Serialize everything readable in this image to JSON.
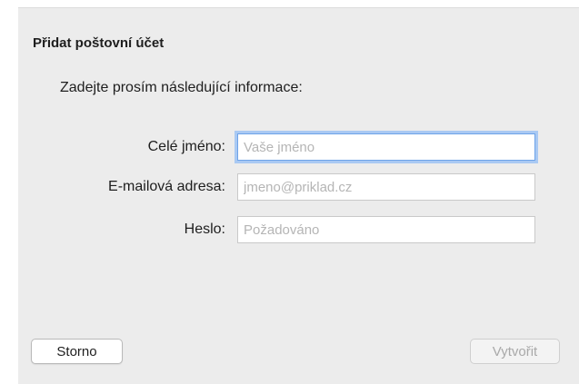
{
  "dialog": {
    "title": "Přidat poštovní účet",
    "subtitle": "Zadejte prosím následující informace:"
  },
  "form": {
    "name": {
      "label": "Celé jméno:",
      "value": "",
      "placeholder": "Vaše jméno"
    },
    "email": {
      "label": "E-mailová adresa:",
      "value": "",
      "placeholder": "jmeno@priklad.cz"
    },
    "password": {
      "label": "Heslo:",
      "value": "",
      "placeholder": "Požadováno"
    }
  },
  "buttons": {
    "cancel_label": "Storno",
    "create_label": "Vytvořit"
  },
  "colors": {
    "dialog_background": "#ececec",
    "focus_ring": "#a9c9f3",
    "disabled_text": "#a9a9a9"
  }
}
